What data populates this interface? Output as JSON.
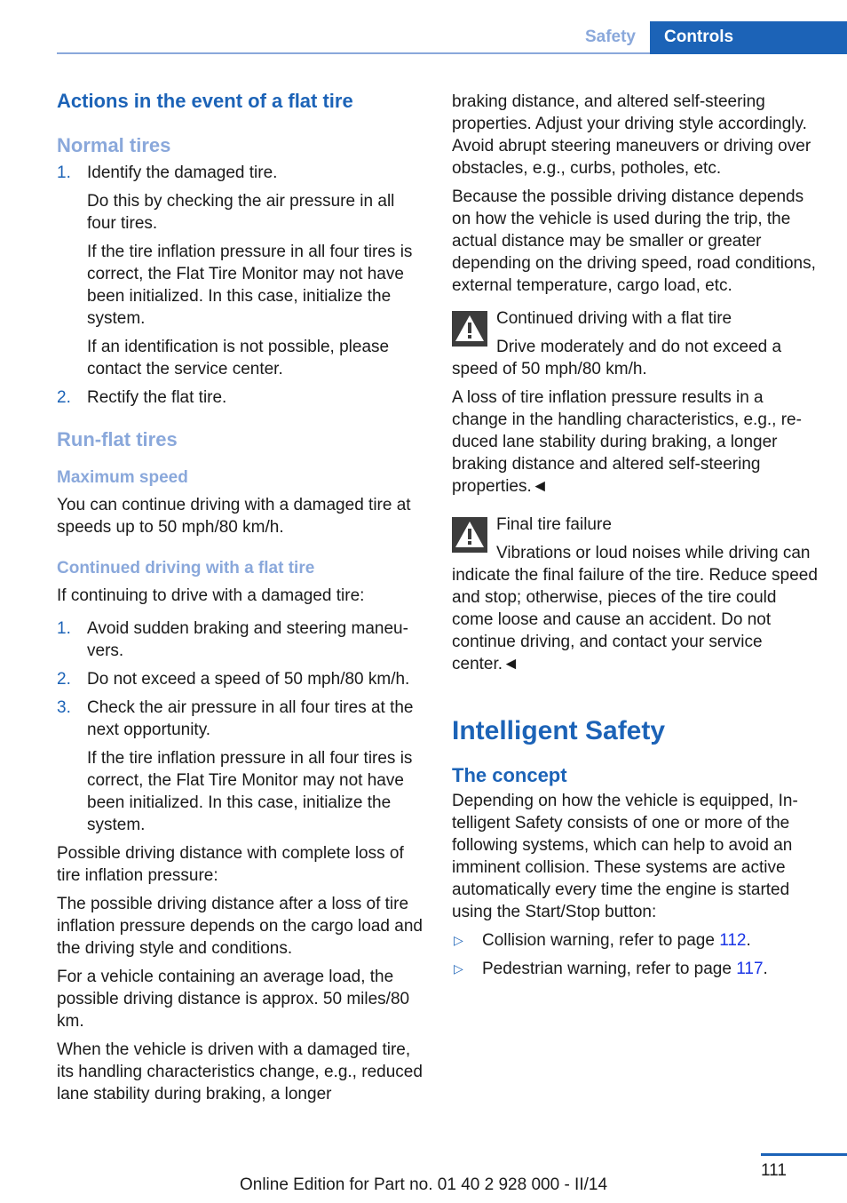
{
  "header": {
    "tab_safety": "Safety",
    "tab_controls": "Controls"
  },
  "left": {
    "title": "Actions in the event of a flat tire",
    "normal_tires": {
      "heading": "Normal tires",
      "steps": [
        {
          "num": "1.",
          "paras": [
            "Identify the damaged tire.",
            "Do this by checking the air pressure in all four tires.",
            "If the tire inflation pressure in all four tires is correct, the Flat Tire Monitor may not have been initialized. In this case, initialize the system.",
            "If an identification is not possible, please contact the service center."
          ]
        },
        {
          "num": "2.",
          "paras": [
            "Rectify the flat tire."
          ]
        }
      ]
    },
    "run_flat": {
      "heading": "Run-flat tires",
      "max_speed_heading": "Maximum speed",
      "max_speed_text": "You can continue driving with a damaged tire at speeds up to 50 mph/80 km/h.",
      "continued_heading": "Continued driving with a flat tire",
      "continued_intro": "If continuing to drive with a damaged tire:",
      "steps": [
        {
          "num": "1.",
          "paras": [
            "Avoid sudden braking and steering maneu­vers."
          ]
        },
        {
          "num": "2.",
          "paras": [
            "Do not exceed a speed of 50 mph/80 km/h."
          ]
        },
        {
          "num": "3.",
          "paras": [
            "Check the air pressure in all four tires at the next opportunity.",
            "If the tire inflation pressure in all four tires is correct, the Flat Tire Monitor may not have been initialized. In this case, initialize the system."
          ]
        }
      ],
      "p1": "Possible driving distance with complete loss of tire inflation pressure:",
      "p2": "The possible driving distance after a loss of tire inflation pressure depends on the cargo load and the driving style and conditions.",
      "p3": "For a vehicle containing an average load, the possible driving distance is approx. 50 miles/80 km.",
      "p4": "When the vehicle is driven with a damaged tire, its handling characteristics change, e.g., re­duced lane stability during braking, a longer"
    }
  },
  "right": {
    "p1": "braking distance, and altered self-steering properties. Adjust your driving style accord­ingly. Avoid abrupt steering maneuvers or driv­ing over obstacles, e.g., curbs, potholes, etc.",
    "p2": "Because the possible driving distance de­pends on how the vehicle is used during the trip, the actual distance may be smaller or greater depending on the driving speed, road conditions, external temperature, cargo load, etc.",
    "warning1": {
      "icon": "warning-triangle-icon",
      "title": "Continued driving with a flat tire",
      "text": "Drive moderately and do not exceed a speed of 50 mph/80 km/h.",
      "text2": "A loss of tire inflation pressure results in a change in the handling characteristics, e.g., re­duced lane stability during braking, a longer braking distance and altered self-steering properties.◄"
    },
    "warning2": {
      "icon": "warning-triangle-icon",
      "title": "Final tire failure",
      "text": "Vibrations or loud noises while driving can indicate the final failure of the tire. Reduce speed and stop; otherwise, pieces of the tire could come loose and cause an accident. Do not continue driving, and contact your service center.◄"
    },
    "section_title": "Intelligent Safety",
    "concept_heading": "The concept",
    "concept_text": "Depending on how the vehicle is equipped, In­telligent Safety consists of one or more of the following systems, which can help to avoid an imminent collision. These systems are active automatically every time the engine is started using the Start/Stop button:",
    "bullets": [
      {
        "icon": "triangle-bullet-icon",
        "text": "Collision warning, refer to page ",
        "page": "112",
        "end": "."
      },
      {
        "icon": "triangle-bullet-icon",
        "text": "Pedestrian warning, refer to page ",
        "page": "117",
        "end": "."
      }
    ]
  },
  "footer": {
    "page_number": "111",
    "edition": "Online Edition for Part no. 01 40 2 928 000 - II/14"
  }
}
